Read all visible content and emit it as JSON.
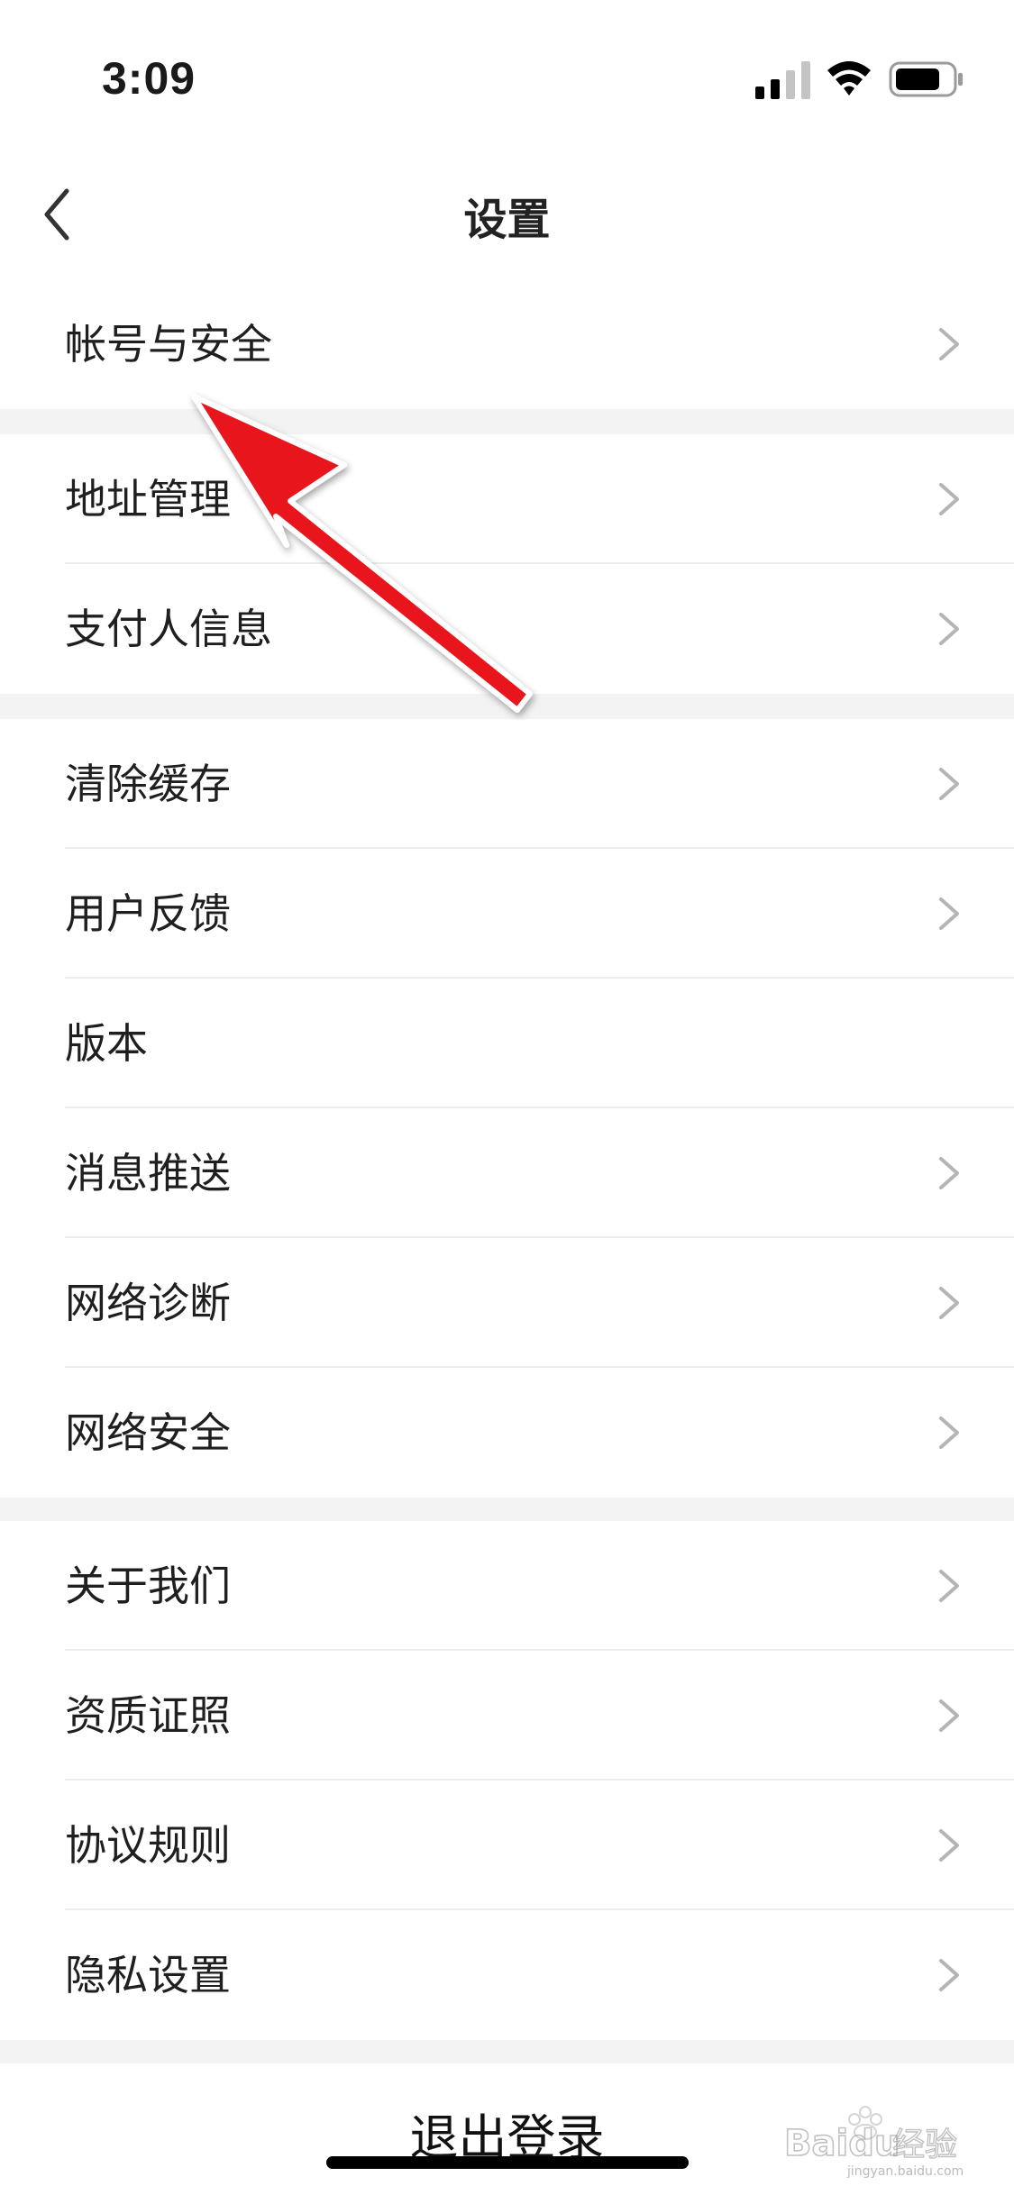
{
  "status_bar": {
    "time": "3:09"
  },
  "nav": {
    "title": "设置",
    "back_icon": "chevron-left-icon"
  },
  "groups": [
    {
      "items": [
        {
          "label": "帐号与安全",
          "chevron": true
        }
      ]
    },
    {
      "items": [
        {
          "label": "地址管理",
          "chevron": true
        },
        {
          "label": "支付人信息",
          "chevron": true
        }
      ]
    },
    {
      "items": [
        {
          "label": "清除缓存",
          "chevron": true
        },
        {
          "label": "用户反馈",
          "chevron": true
        },
        {
          "label": "版本",
          "chevron": false
        },
        {
          "label": "消息推送",
          "chevron": true
        },
        {
          "label": "网络诊断",
          "chevron": true
        },
        {
          "label": "网络安全",
          "chevron": true
        }
      ]
    },
    {
      "items": [
        {
          "label": "关于我们",
          "chevron": true
        },
        {
          "label": "资质证照",
          "chevron": true
        },
        {
          "label": "协议规则",
          "chevron": true
        },
        {
          "label": "隐私设置",
          "chevron": true
        }
      ]
    }
  ],
  "logout": {
    "label": "退出登录"
  },
  "watermark": {
    "text_latin": "Baidu",
    "text_cn": "经验",
    "sub": "jingyan.baidu.com"
  },
  "colors": {
    "background": "#f3f3f3",
    "annotation_arrow": "#e8141c",
    "chevron": "#b5b5b5"
  }
}
